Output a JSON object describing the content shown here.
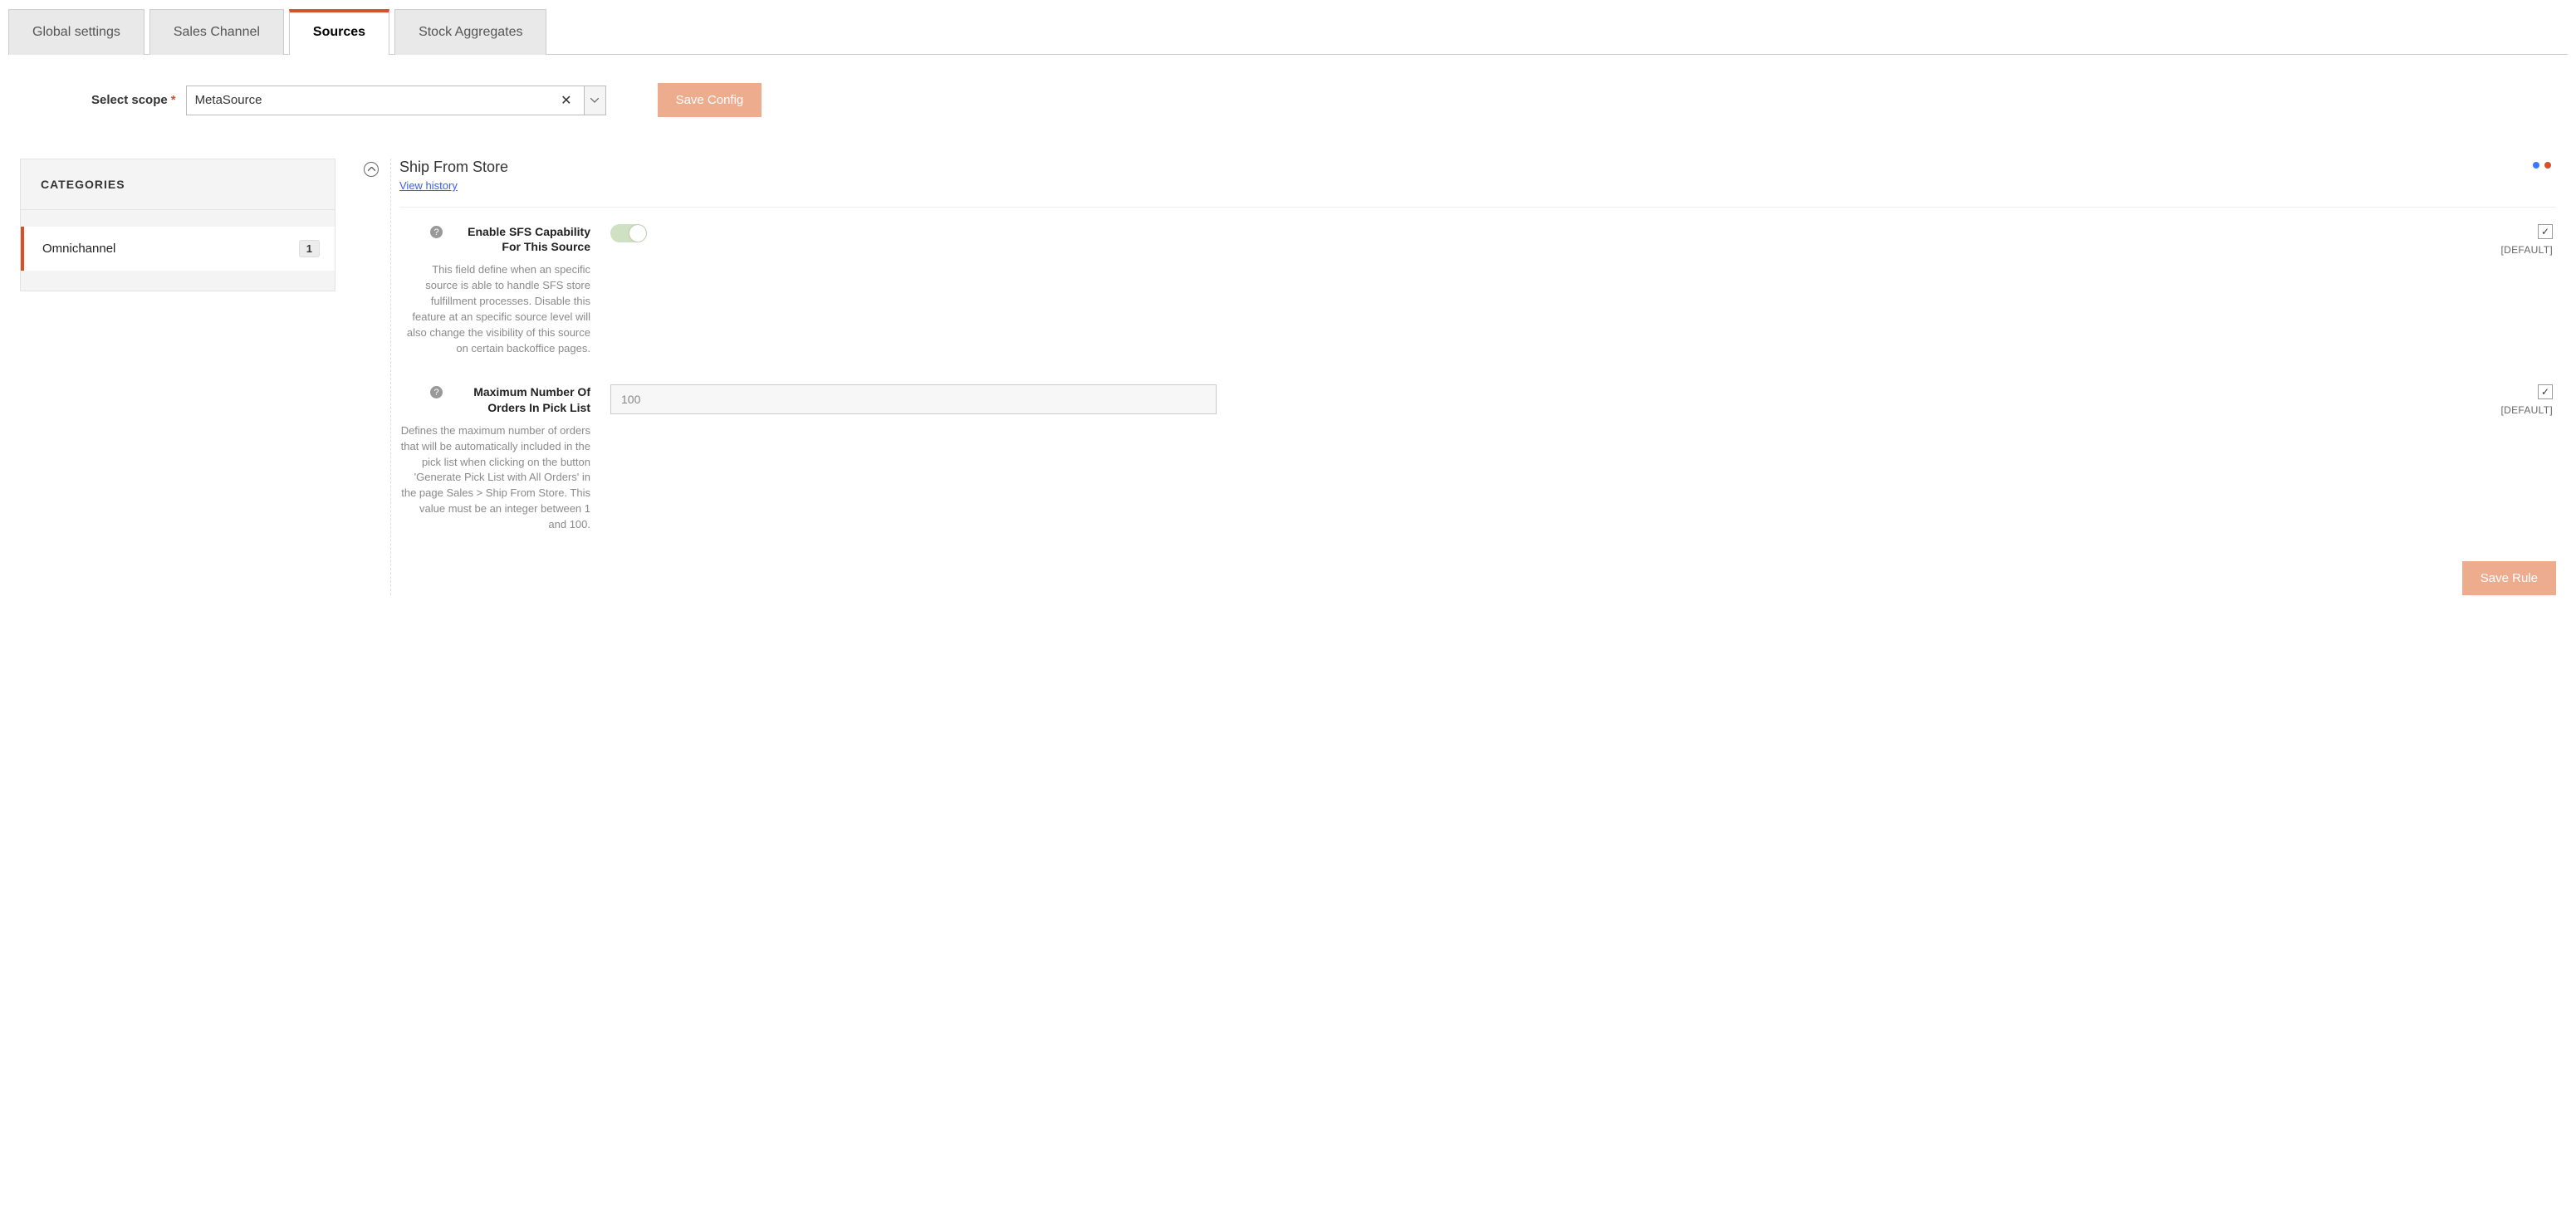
{
  "tabs": [
    {
      "label": "Global settings",
      "active": false
    },
    {
      "label": "Sales Channel",
      "active": false
    },
    {
      "label": "Sources",
      "active": true
    },
    {
      "label": "Stock Aggregates",
      "active": false
    }
  ],
  "scope": {
    "label": "Select scope",
    "value": "MetaSource"
  },
  "buttons": {
    "save_config": "Save Config",
    "save_rule": "Save Rule"
  },
  "sidebar": {
    "heading": "CATEGORIES",
    "items": [
      {
        "label": "Omnichannel",
        "count": "1"
      }
    ]
  },
  "section": {
    "title": "Ship From Store",
    "view_history": "View history"
  },
  "fields": {
    "enable_sfs": {
      "label": "Enable SFS Capability For This Source",
      "hint": "This field define when an specific source is able to handle SFS store fulfillment processes. Disable this feature at an specific source level will also change the visibility of this source on certain backoffice pages.",
      "toggle_on": true,
      "default_label": "[DEFAULT]",
      "default_checked": true
    },
    "max_orders": {
      "label": "Maximum Number Of Orders In Pick List",
      "hint": "Defines the maximum number of orders that will be automatically included in the pick list when clicking on the button 'Generate Pick List with All Orders' in the page Sales > Ship From Store. This value must be an integer between 1 and 100.",
      "value": "100",
      "default_label": "[DEFAULT]",
      "default_checked": true
    }
  }
}
